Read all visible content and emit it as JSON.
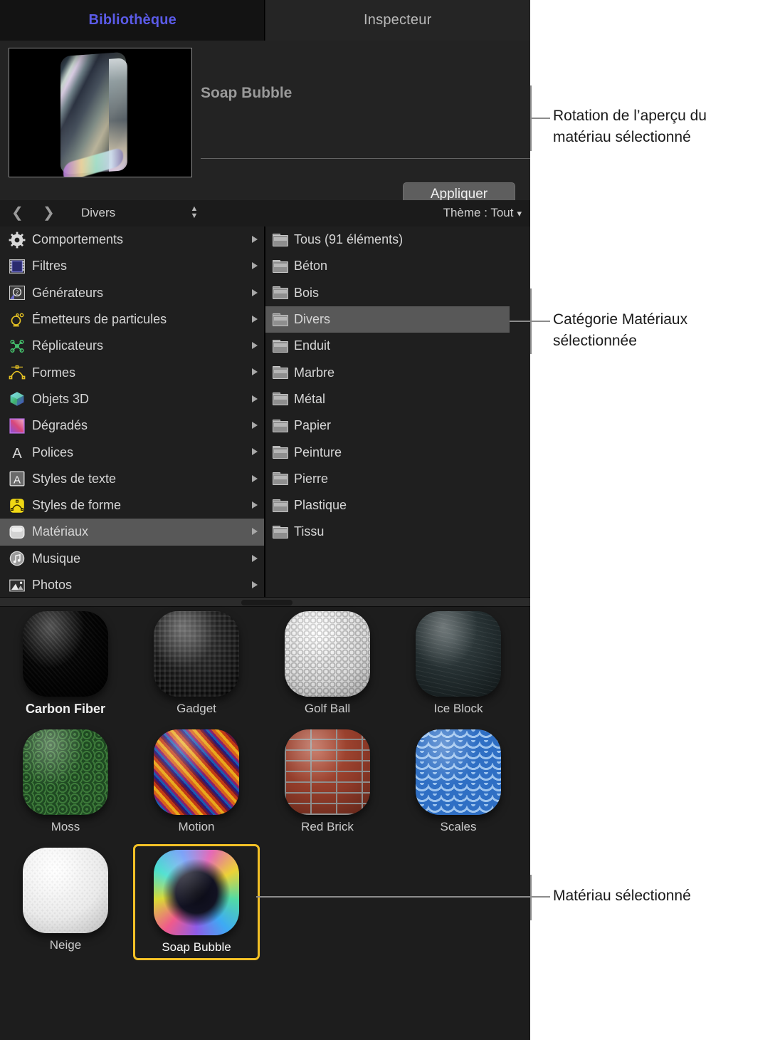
{
  "tabs": [
    {
      "label": "Bibliothèque",
      "active": true
    },
    {
      "label": "Inspecteur",
      "active": false
    }
  ],
  "preview": {
    "material_name": "Soap Bubble",
    "apply_label": "Appliquer",
    "thumbnail_icon": "material-preview-thumbnail"
  },
  "navbar": {
    "back_icon": "chevron-left-icon",
    "forward_icon": "chevron-right-icon",
    "path_label": "Divers",
    "stepper_icon": "sort-stepper-icon",
    "theme_label": "Thème : Tout",
    "theme_caret": "chevron-down-icon"
  },
  "sidebar": {
    "items": [
      {
        "label": "Comportements",
        "icon": "gear-icon",
        "selected": false
      },
      {
        "label": "Filtres",
        "icon": "filmstrip-icon",
        "selected": false
      },
      {
        "label": "Générateurs",
        "icon": "generator-icon",
        "selected": false
      },
      {
        "label": "Émetteurs de particules",
        "icon": "particle-emitter-icon",
        "selected": false
      },
      {
        "label": "Réplicateurs",
        "icon": "replicator-icon",
        "selected": false
      },
      {
        "label": "Formes",
        "icon": "shape-icon",
        "selected": false
      },
      {
        "label": "Objets 3D",
        "icon": "cube-3d-icon",
        "selected": false
      },
      {
        "label": "Dégradés",
        "icon": "gradient-icon",
        "selected": false
      },
      {
        "label": "Polices",
        "icon": "font-icon",
        "selected": false
      },
      {
        "label": "Styles de texte",
        "icon": "text-style-icon",
        "selected": false
      },
      {
        "label": "Styles de forme",
        "icon": "shape-style-icon",
        "selected": false
      },
      {
        "label": "Matériaux",
        "icon": "material-icon",
        "selected": true
      },
      {
        "label": "Musique",
        "icon": "music-note-icon",
        "selected": false
      },
      {
        "label": "Photos",
        "icon": "photo-icon",
        "selected": false
      }
    ]
  },
  "folders": {
    "items": [
      {
        "label": "Tous (91 éléments)",
        "icon": "folder-icon",
        "selected": false
      },
      {
        "label": "Béton",
        "icon": "folder-icon",
        "selected": false
      },
      {
        "label": "Bois",
        "icon": "folder-icon",
        "selected": false
      },
      {
        "label": "Divers",
        "icon": "folder-icon",
        "selected": true
      },
      {
        "label": "Enduit",
        "icon": "folder-icon",
        "selected": false
      },
      {
        "label": "Marbre",
        "icon": "folder-icon",
        "selected": false
      },
      {
        "label": "Métal",
        "icon": "folder-icon",
        "selected": false
      },
      {
        "label": "Papier",
        "icon": "folder-icon",
        "selected": false
      },
      {
        "label": "Peinture",
        "icon": "folder-icon",
        "selected": false
      },
      {
        "label": "Pierre",
        "icon": "folder-icon",
        "selected": false
      },
      {
        "label": "Plastique",
        "icon": "folder-icon",
        "selected": false
      },
      {
        "label": "Tissu",
        "icon": "folder-icon",
        "selected": false
      }
    ]
  },
  "splitter": {
    "handle_icon": "resize-handle-icon"
  },
  "grid": {
    "items": [
      {
        "label": "Carbon Fiber",
        "swatch": "sw-carbon",
        "selected": false,
        "strong": true
      },
      {
        "label": "Gadget",
        "swatch": "sw-gadget",
        "selected": false,
        "strong": false
      },
      {
        "label": "Golf Ball",
        "swatch": "sw-golf",
        "selected": false,
        "strong": false
      },
      {
        "label": "Ice Block",
        "swatch": "sw-ice",
        "selected": false,
        "strong": false
      },
      {
        "label": "Moss",
        "swatch": "sw-moss",
        "selected": false,
        "strong": false
      },
      {
        "label": "Motion",
        "swatch": "sw-motion",
        "selected": false,
        "strong": false
      },
      {
        "label": "Red Brick",
        "swatch": "sw-brick",
        "selected": false,
        "strong": false
      },
      {
        "label": "Scales",
        "swatch": "sw-scales",
        "selected": false,
        "strong": false
      },
      {
        "label": "Neige",
        "swatch": "sw-snow",
        "selected": false,
        "strong": false
      },
      {
        "label": "Soap Bubble",
        "swatch": "sw-soap",
        "selected": true,
        "strong": false
      }
    ]
  },
  "callouts": [
    {
      "line1": "Rotation de l’aperçu du",
      "line2": "matériau sélectionné"
    },
    {
      "line1": "Catégorie Matériaux",
      "line2": "sélectionnée"
    },
    {
      "line1": "Matériau sélectionné",
      "line2": ""
    }
  ],
  "colors": {
    "accent_tab": "#5b5be8",
    "selection_yellow": "#f2c026",
    "row_selected": "#585858",
    "panel_bg": "#1f1f1f"
  }
}
